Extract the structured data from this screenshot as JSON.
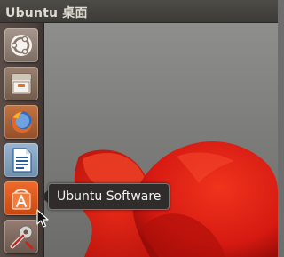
{
  "top_panel": {
    "title": "Ubuntu 桌面"
  },
  "launcher": {
    "items": [
      {
        "name": "dash-home",
        "icon": "ubuntu-logo-icon",
        "color": "#9c8a7e"
      },
      {
        "name": "files",
        "icon": "file-cabinet-icon",
        "color": "#8d7563"
      },
      {
        "name": "firefox",
        "icon": "firefox-icon",
        "color": "#b8612e"
      },
      {
        "name": "libreoffice-writer",
        "icon": "document-icon",
        "color": "#86a6c4"
      },
      {
        "name": "ubuntu-software",
        "icon": "shopping-bag-icon",
        "color": "#e05a1c"
      },
      {
        "name": "system-settings",
        "icon": "wrench-icon",
        "color": "#8a7268"
      }
    ]
  },
  "tooltip": {
    "text": "Ubuntu Software"
  },
  "colors": {
    "panel": "#3c3b37",
    "accent": "#e05a1c",
    "flower": "#e8231a"
  }
}
